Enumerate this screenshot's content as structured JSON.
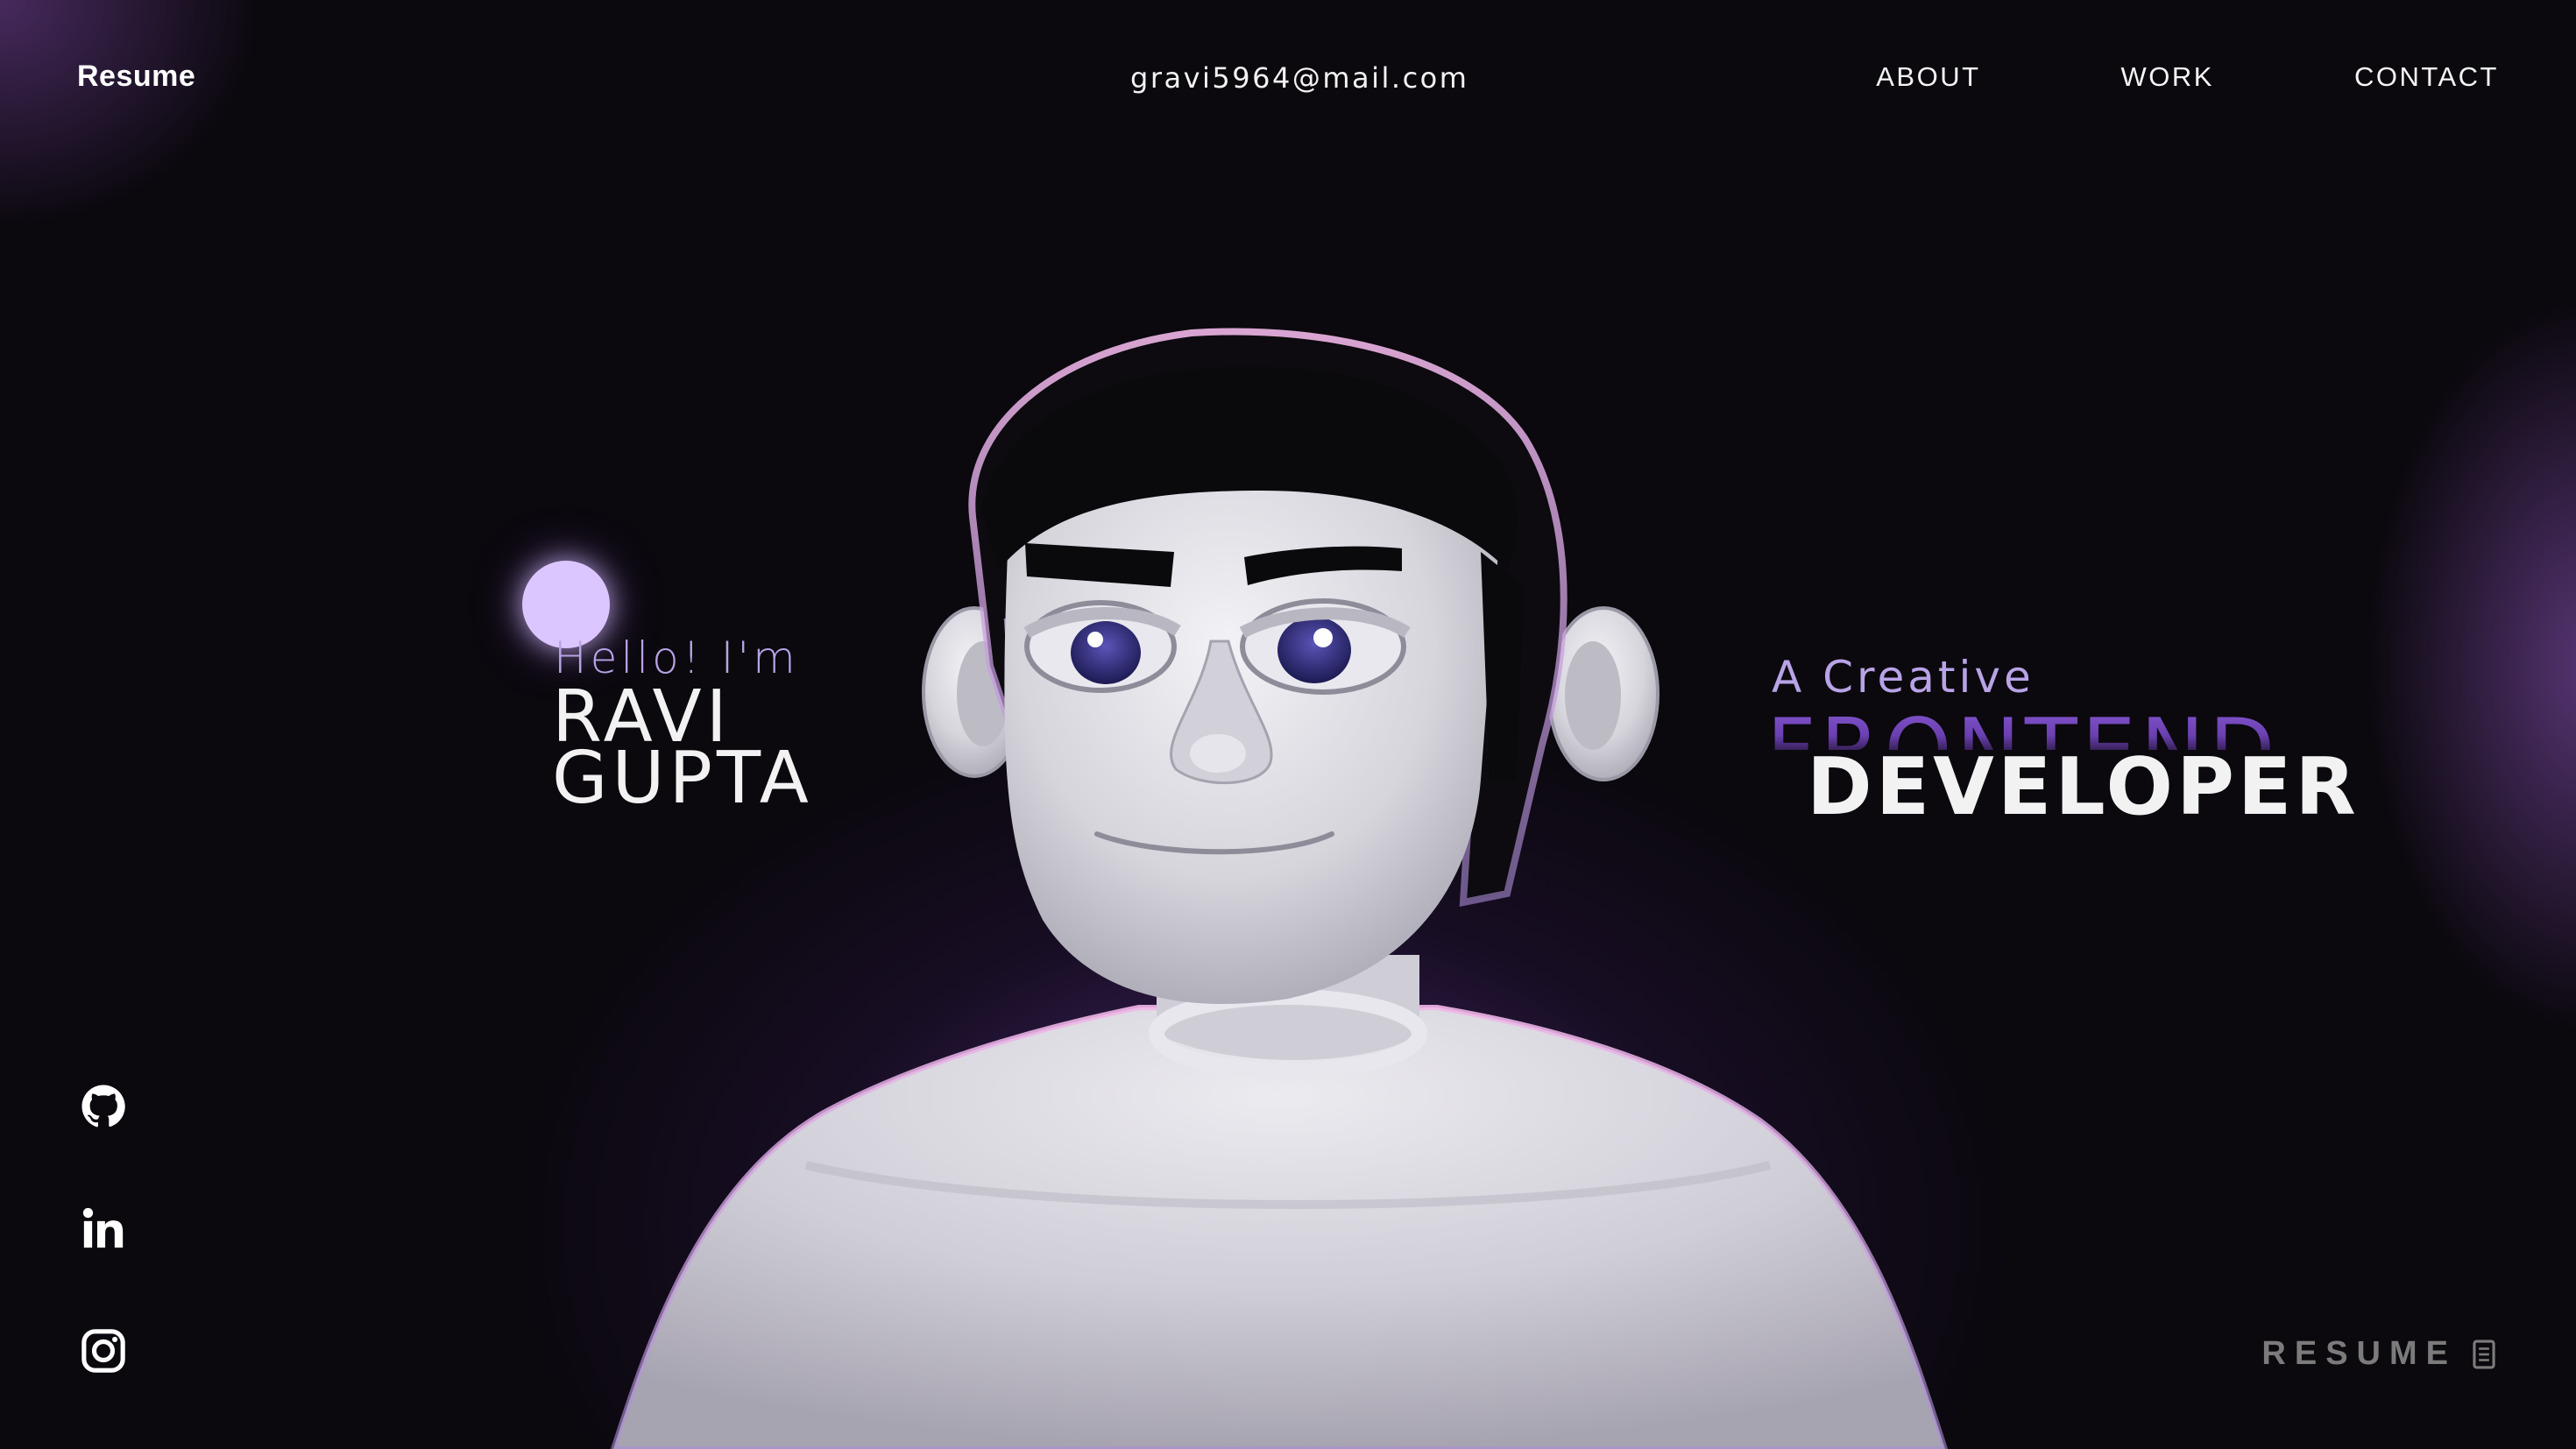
{
  "header": {
    "logo": "Resume",
    "email": "gravi5964@mail.com",
    "nav": [
      "ABOUT",
      "WORK",
      "CONTACT"
    ]
  },
  "intro": {
    "greeting": "Hello! I'm",
    "first_name": "RAVI",
    "last_name": "GUPTA"
  },
  "role": {
    "prefix": "A Creative",
    "title_back": "FRONTEND",
    "title_front": "DEVELOPER"
  },
  "socials": [
    {
      "icon": "github-icon"
    },
    {
      "icon": "linkedin-icon"
    },
    {
      "icon": "instagram-icon"
    }
  ],
  "resume_button": {
    "label": "RESUME",
    "icon": "document-icon"
  },
  "colors": {
    "background": "#0b080e",
    "accent": "#b8a3e6",
    "glow": "#8a5cd6",
    "dot": "#dcc6ff"
  }
}
